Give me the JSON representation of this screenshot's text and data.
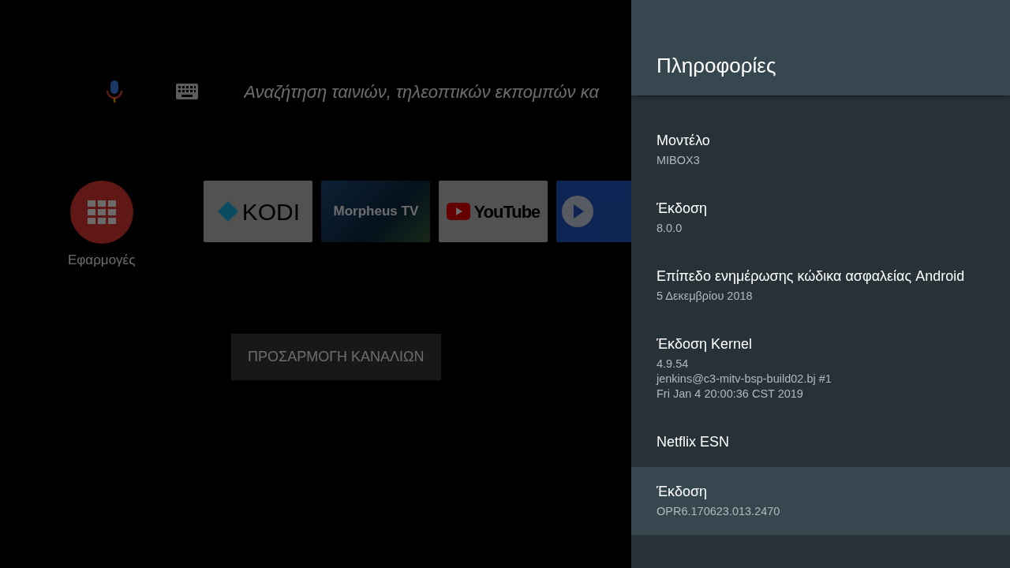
{
  "search": {
    "placeholder": "Αναζήτηση ταινιών, τηλεοπτικών εκπομπών κα"
  },
  "apps_button": {
    "label": "Εφαρμογές"
  },
  "app_tiles": [
    {
      "kind": "kodi",
      "label": "KODI"
    },
    {
      "kind": "morpheus",
      "label": "Morpheus TV"
    },
    {
      "kind": "youtube",
      "label": "YouTube"
    },
    {
      "kind": "play"
    }
  ],
  "channels_button": {
    "label": "ΠΡΟΣΑΡΜΟΓΗ ΚΑΝΑΛΙΩΝ"
  },
  "panel": {
    "title": "Πληροφορίες",
    "items": [
      {
        "title": "Μοντέλο",
        "values": [
          "MIBOX3"
        ],
        "selected": false
      },
      {
        "title": "Έκδοση",
        "values": [
          "8.0.0"
        ],
        "selected": false
      },
      {
        "title": "Επίπεδο ενημέρωσης κώδικα ασφαλείας Android",
        "values": [
          "5 Δεκεμβρίου 2018"
        ],
        "selected": false
      },
      {
        "title": "Έκδοση Kernel",
        "values": [
          "4.9.54",
          "jenkins@c3-mitv-bsp-build02.bj #1",
          "Fri Jan 4 20:00:36 CST 2019"
        ],
        "selected": false
      },
      {
        "title": "Netflix ESN",
        "selected": false
      },
      {
        "title": "Έκδοση",
        "values": [
          "OPR6.170623.013.2470"
        ],
        "selected": true
      }
    ]
  }
}
